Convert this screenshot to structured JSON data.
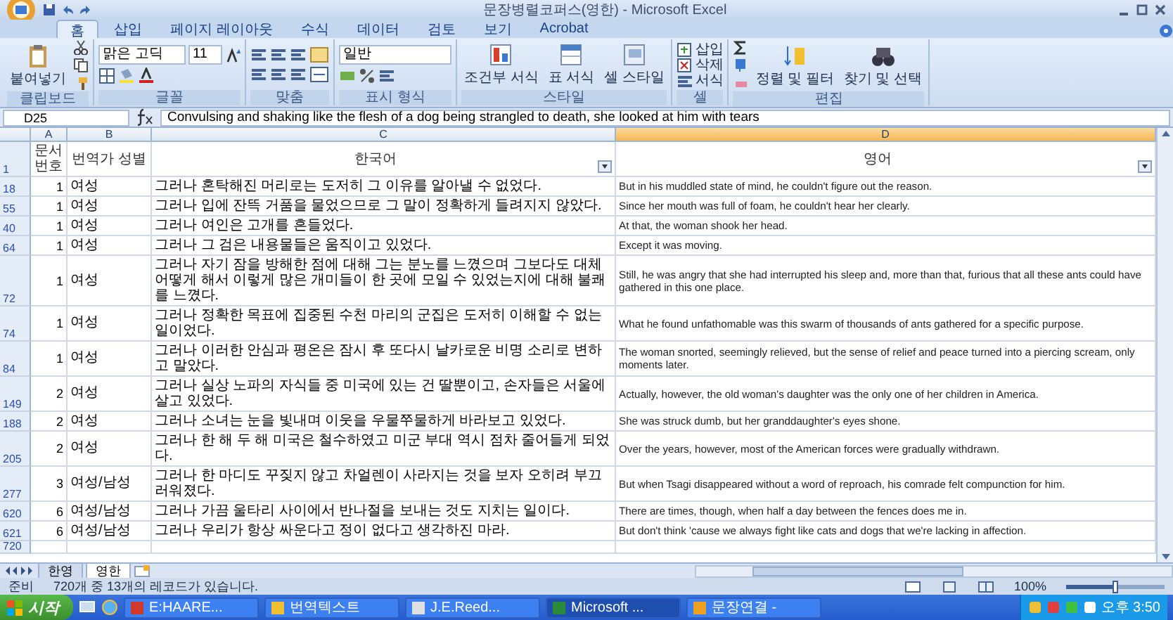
{
  "window": {
    "title": "문장병렬코퍼스(영한) - Microsoft Excel"
  },
  "ribbon": {
    "tabs": [
      {
        "label": "홈",
        "selected": true
      },
      {
        "label": "삽입",
        "selected": false
      },
      {
        "label": "페이지 레이아웃",
        "selected": false
      },
      {
        "label": "수식",
        "selected": false
      },
      {
        "label": "데이터",
        "selected": false
      },
      {
        "label": "검토",
        "selected": false
      },
      {
        "label": "보기",
        "selected": false
      },
      {
        "label": "Acrobat",
        "selected": false
      }
    ],
    "groups": [
      {
        "kind": "clipboard",
        "label": "클립보드",
        "buttons": [
          "붙여넣기"
        ]
      },
      {
        "kind": "font",
        "label": "글꼴",
        "font": "맑은 고딕",
        "size": "11"
      },
      {
        "kind": "align",
        "label": "맞춤"
      },
      {
        "kind": "number",
        "label": "표시 형식",
        "format": "일반"
      },
      {
        "kind": "styles",
        "label": "스타일",
        "buttons": [
          "조건부 서식",
          "표 서식",
          "셀 스타일"
        ]
      },
      {
        "kind": "cells",
        "label": "셀",
        "buttons": [
          "삽입",
          "삭제",
          "서식"
        ]
      },
      {
        "kind": "edit",
        "label": "편집",
        "buttons": [
          "정렬 및 필터",
          "찾기 및 선택"
        ]
      }
    ]
  },
  "formula_bar": {
    "name_box": "D25",
    "value": "Convulsing and shaking like the flesh of a dog being strangled to death, she looked at him with tears"
  },
  "sheet": {
    "columns": [
      {
        "letter": "A",
        "selected": false
      },
      {
        "letter": "B",
        "selected": false
      },
      {
        "letter": "C",
        "selected": false
      },
      {
        "letter": "D",
        "selected": true
      }
    ],
    "header": {
      "row": "1",
      "cells": [
        {
          "label": "문서 번호",
          "filter": false
        },
        {
          "label": "번역가 성별",
          "filter": false
        },
        {
          "label": "한국어",
          "filter": true
        },
        {
          "label": "영어",
          "filter": true
        }
      ]
    },
    "rows": [
      {
        "row": "18",
        "doc": "1",
        "gender": "여성",
        "korean": "그러나 혼탁해진 머리로는 도저히 그 이유를 알아낼 수 없었다.",
        "english": "But in his muddled state of mind, he couldn't figure out the reason."
      },
      {
        "row": "55",
        "doc": "1",
        "gender": "여성",
        "korean": "그러나 입에 잔뜩 거품을 물었으므로 그 말이 정확하게 들려지지 않았다.",
        "english": "Since her mouth was full of foam, he couldn't hear her clearly."
      },
      {
        "row": "40",
        "doc": "1",
        "gender": "여성",
        "korean": "그러나 여인은 고개를 흔들었다.",
        "english": "At that, the woman shook her head."
      },
      {
        "row": "64",
        "doc": "1",
        "gender": "여성",
        "korean": "그러나 그 검은 내용물들은 움직이고 있었다.",
        "english": "Except it was moving."
      },
      {
        "row": "72",
        "doc": "1",
        "gender": "여성",
        "korean": "그러나 자기 잠을 방해한 점에 대해 그는 분노를 느꼈으며 그보다도 대체 어떻게 해서 이렇게 많은 개미들이 한 곳에 모일 수 있었는지에 대해 불쾌를 느꼈다.",
        "english": "Still, he was angry that she had interrupted his sleep and, more than that, furious that all these ants could have gathered in this one place."
      },
      {
        "row": "74",
        "doc": "1",
        "gender": "여성",
        "korean": "그러나 정확한 목표에 집중된 수천 마리의 군집은 도저히 이해할 수 없는 일이었다.",
        "english": "What he found unfathomable was this swarm of thousands of ants gathered for a specific purpose."
      },
      {
        "row": "84",
        "doc": "1",
        "gender": "여성",
        "korean": "그러나 이러한 안심과 평온은 잠시 후 또다시 날카로운 비명 소리로 변하고 말았다.",
        "english": "The woman snorted, seemingly relieved, but the sense of relief and peace turned into a piercing scream, only moments later."
      },
      {
        "row": "149",
        "doc": "2",
        "gender": "여성",
        "korean": "그러나 실상 노파의 자식들 중 미국에 있는 건 딸뿐이고, 손자들은 서울에 살고 있었다.",
        "english": "Actually, however, the old woman's daughter was the only one of her children in America."
      },
      {
        "row": "188",
        "doc": "2",
        "gender": "여성",
        "korean": "그러나 소녀는 눈을 빛내며 이웃을 우물쭈물하게 바라보고 있었다.",
        "english": "She was struck dumb, but her granddaughter's eyes shone."
      },
      {
        "row": "205",
        "doc": "2",
        "gender": "여성",
        "korean": "그러나 한 해 두 해 미국은 철수하였고 미군 부대 역시 점차 줄어들게 되었다.",
        "english": "Over the years, however, most of the American forces were gradually withdrawn."
      },
      {
        "row": "277",
        "doc": "3",
        "gender": "여성/남성",
        "korean": "그러나 한 마디도 꾸짖지 않고 차얼렌이 사라지는 것을 보자 오히려 부끄러워졌다.",
        "english": "But when Tsagi disappeared without a word of reproach, his comrade felt compunction for him."
      },
      {
        "row": "620",
        "doc": "6",
        "gender": "여성/남성",
        "korean": "그러나 가끔 울타리 사이에서 반나절을 보내는 것도 지치는 일이다.",
        "english": "There are times, though, when half a day between the fences does me in."
      },
      {
        "row": "621",
        "doc": "6",
        "gender": "여성/남성",
        "korean": "그러나 우리가 항상 싸운다고 정이 없다고 생각하진 마라.",
        "english": "But don't think 'cause we always fight like cats and dogs that we're lacking in affection."
      }
    ],
    "empty_row": "720"
  },
  "sheet_tabs": [
    {
      "label": "한영",
      "selected": false
    },
    {
      "label": "영한",
      "selected": true
    }
  ],
  "status_bar": {
    "mode": "준비",
    "message": "720개 중 13개의 레코드가 있습니다.",
    "zoom": "100%",
    "zoom_slider": {
      "level": 0.5
    }
  },
  "taskbar": {
    "start": "시작",
    "items": [
      {
        "label": "E:HAARE...",
        "selected": false
      },
      {
        "label": "번역텍스트",
        "selected": false
      },
      {
        "label": "J.E.Reed...",
        "selected": false
      },
      {
        "label": "Microsoft ...",
        "selected": true
      },
      {
        "label": "문장연결 -",
        "selected": false
      }
    ],
    "clock": "오후 3:50"
  }
}
